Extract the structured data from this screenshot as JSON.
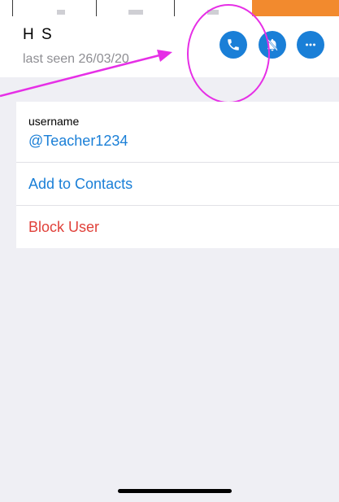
{
  "profile": {
    "name": "H S",
    "last_seen": "last seen 26/03/20"
  },
  "actions": {
    "call_icon": "phone-icon",
    "mute_icon": "bell-mute-icon",
    "more_icon": "ellipsis-icon"
  },
  "info": {
    "username_label": "username",
    "username_value": "@Teacher1234",
    "add_contacts": "Add to Contacts",
    "block_user": "Block User"
  },
  "colors": {
    "accent": "#1a7fd7",
    "danger": "#e0413a",
    "annotation": "#e62fe6",
    "background": "#efeff4",
    "tab_highlight": "#f28a2e"
  }
}
